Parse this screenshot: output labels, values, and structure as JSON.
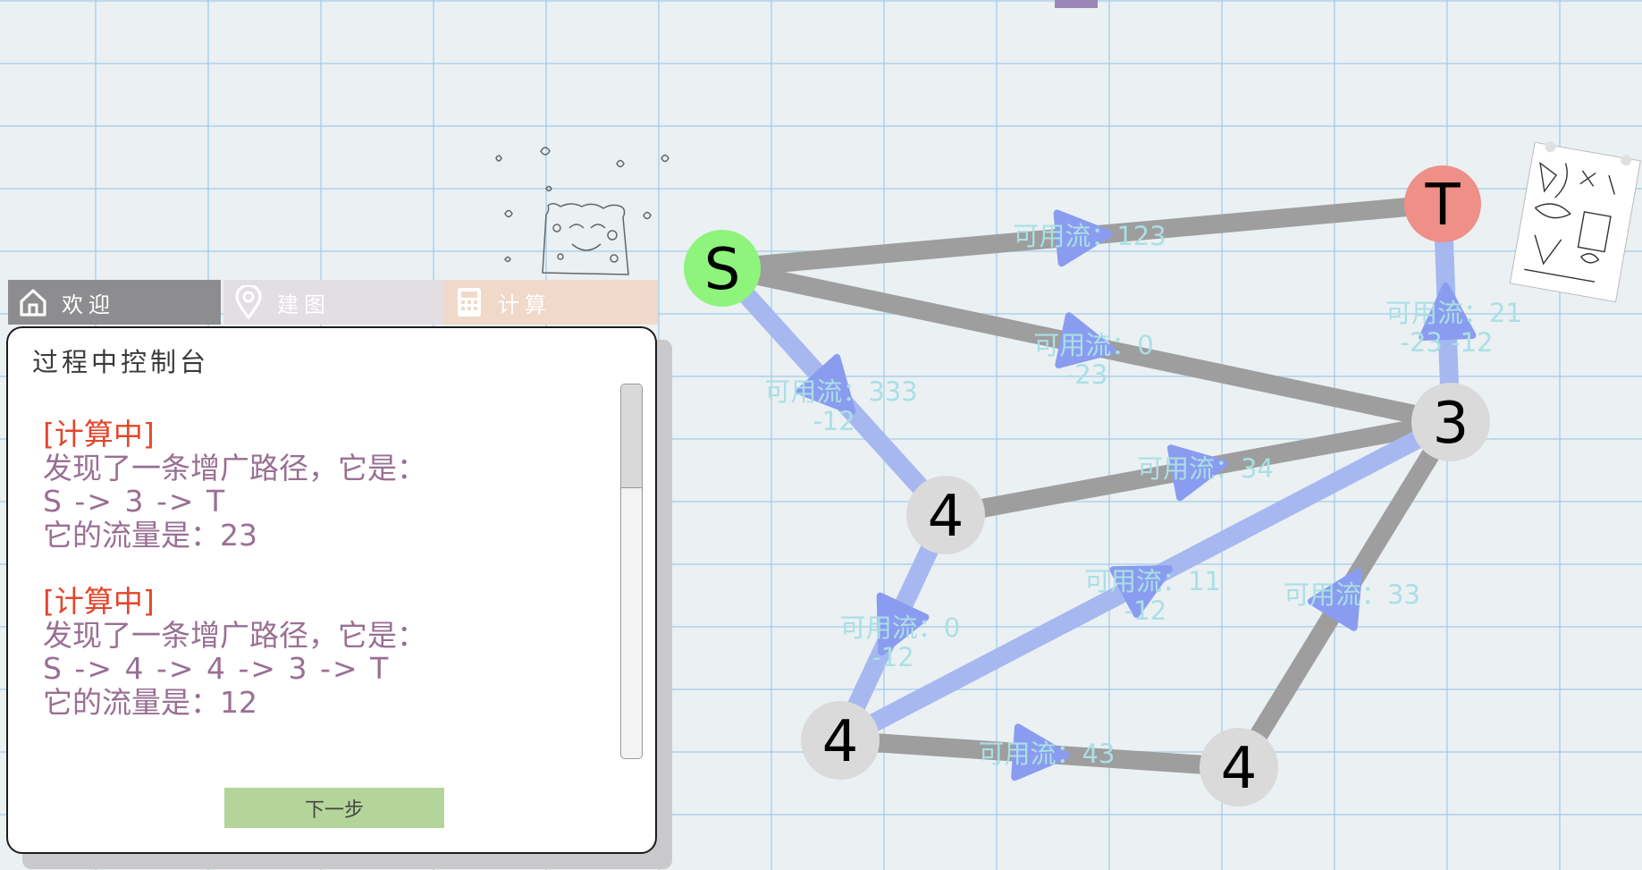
{
  "tabs": [
    {
      "label": "欢迎",
      "icon": "home-icon"
    },
    {
      "label": "建图",
      "icon": "map-pin-icon"
    },
    {
      "label": "计算",
      "icon": "calculator-icon"
    }
  ],
  "console": {
    "title": "过程中控制台",
    "entries": [
      {
        "tag": "[计算中]",
        "line1": "发现了一条增广路径，它是：",
        "path": "S -> 3 -> T",
        "flow": "它的流量是：23"
      },
      {
        "tag": "[计算中]",
        "line1": "发现了一条增广路径，它是：",
        "path": "S -> 4 -> 4 -> 3 -> T",
        "flow": "它的流量是：12"
      }
    ],
    "next_button": "下一步"
  },
  "graph": {
    "colors": {
      "used_edge": "#a6b8ef",
      "unused_edge": "#9e9e9e",
      "arrow": "#8a9cf0",
      "source": "#8ef47c",
      "sink": "#ee8f88",
      "node": "#dadada",
      "label": "#a9e0e4"
    },
    "nodes": [
      {
        "id": "S",
        "label": "S"
      },
      {
        "id": "T",
        "label": "T"
      },
      {
        "id": "n3",
        "label": "3"
      },
      {
        "id": "n4a",
        "label": "4"
      },
      {
        "id": "n4b",
        "label": "4"
      },
      {
        "id": "n4c",
        "label": "4"
      }
    ],
    "edges": [
      {
        "from": "S",
        "to": "T",
        "used": false,
        "label1": "可用流：123",
        "label2": ""
      },
      {
        "from": "S",
        "to": "n3",
        "used": false,
        "label1": "可用流：0",
        "label2": "-23"
      },
      {
        "from": "S",
        "to": "n4a",
        "used": true,
        "label1": "可用流：333",
        "label2": "-12"
      },
      {
        "from": "n3",
        "to": "T",
        "used": true,
        "label1": "可用流：21",
        "label2": "-23 -12"
      },
      {
        "from": "n4a",
        "to": "n3",
        "used": false,
        "label1": "可用流：34",
        "label2": ""
      },
      {
        "from": "n4a",
        "to": "n4b",
        "used": true,
        "label1": "可用流：0",
        "label2": "-12"
      },
      {
        "from": "n4b",
        "to": "n3",
        "used": true,
        "label1": "可用流：11",
        "label2": "-12"
      },
      {
        "from": "n4b",
        "to": "n4c",
        "used": false,
        "label1": "可用流：43",
        "label2": ""
      },
      {
        "from": "n4c",
        "to": "n3",
        "used": false,
        "label1": "可用流：33",
        "label2": ""
      }
    ]
  }
}
